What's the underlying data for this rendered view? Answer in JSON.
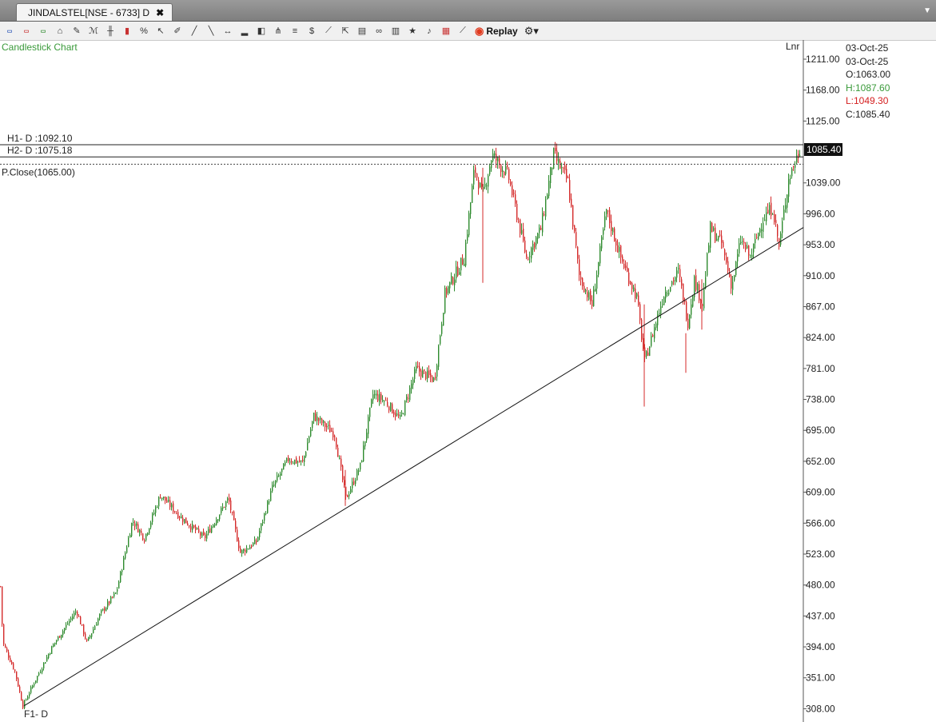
{
  "window": {
    "tab_title": "JINDALSTEL[NSE - 6733] D",
    "tab_close": "✖"
  },
  "toolbar": {
    "icons": [
      "buy-icon",
      "sell-icon",
      "trade-icon",
      "indicator-icon",
      "draw-icon",
      "studies-icon",
      "bar-style-icon",
      "candle-style-icon",
      "scale-icon",
      "cursor-icon",
      "pencil-icon",
      "line-icon",
      "diagonal-line-icon",
      "horizontal-ray-icon",
      "volume-icon",
      "cube-icon",
      "fork-icon",
      "equal-lines-icon",
      "dollar-icon",
      "ruler-icon",
      "export-icon",
      "template-icon",
      "link-icon",
      "layout-icon",
      "star-icon",
      "alert-icon",
      "hierarchy-icon",
      "trend-icon"
    ],
    "replay_label": "Replay",
    "replay_icon": "replay-icon",
    "settings_icon": "gear-icon"
  },
  "chart_label": "Candlestick Chart",
  "scale_mode": "Lnr",
  "ohlc": {
    "date1": "03-Oct-25",
    "date2": "03-Oct-25",
    "open": "O:1063.00",
    "high": "H:1087.60",
    "low": "L:1049.30",
    "close": "C:1085.40"
  },
  "colors": {
    "up": "#2e8b2e",
    "down": "#d42a2a",
    "label_green": "#3a9a3a",
    "label_red": "#d42020",
    "price_tag_bg": "#111111",
    "price_tag_text": "#ffffff"
  },
  "chart_data": {
    "type": "candlestick",
    "symbol": "JINDALSTEL",
    "interval": "D",
    "ylim": [
      300,
      1220
    ],
    "y_ticks": [
      "1211.00",
      "1168.00",
      "1125.00",
      "1085.40",
      "1039.00",
      "996.00",
      "953.00",
      "910.00",
      "867.00",
      "824.00",
      "781.00",
      "738.00",
      "695.00",
      "652.00",
      "609.00",
      "566.00",
      "523.00",
      "480.00",
      "437.00",
      "394.00",
      "351.00",
      "308.00"
    ],
    "y_tick_values": [
      1211,
      1168,
      1125,
      1085.4,
      1039,
      996,
      953,
      910,
      867,
      824,
      781,
      738,
      695,
      652,
      609,
      566,
      523,
      480,
      437,
      394,
      351,
      308
    ],
    "last_price": "1085.40",
    "last_price_value": 1085.4,
    "horizontal_levels": [
      {
        "label": "H1- D :1092.10",
        "value": 1092.1
      },
      {
        "label": "H2- D :1075.18",
        "value": 1075.18
      }
    ],
    "previous_close": {
      "label": "P.Close(1065.00)",
      "value": 1065.0
    },
    "trendline": {
      "label": "F1- D",
      "start_value": 312,
      "end_value": 977
    },
    "price_path": [
      {
        "i": 0,
        "v": 478
      },
      {
        "i": 3,
        "v": 400
      },
      {
        "i": 18,
        "v": 360
      },
      {
        "i": 28,
        "v": 312
      },
      {
        "i": 40,
        "v": 340
      },
      {
        "i": 65,
        "v": 395
      },
      {
        "i": 95,
        "v": 445
      },
      {
        "i": 108,
        "v": 400
      },
      {
        "i": 125,
        "v": 440
      },
      {
        "i": 145,
        "v": 470
      },
      {
        "i": 165,
        "v": 570
      },
      {
        "i": 180,
        "v": 545
      },
      {
        "i": 200,
        "v": 605
      },
      {
        "i": 225,
        "v": 575
      },
      {
        "i": 255,
        "v": 545
      },
      {
        "i": 285,
        "v": 600
      },
      {
        "i": 300,
        "v": 525
      },
      {
        "i": 320,
        "v": 540
      },
      {
        "i": 340,
        "v": 615
      },
      {
        "i": 360,
        "v": 655
      },
      {
        "i": 378,
        "v": 650
      },
      {
        "i": 392,
        "v": 715
      },
      {
        "i": 418,
        "v": 690
      },
      {
        "i": 432,
        "v": 600
      },
      {
        "i": 450,
        "v": 645
      },
      {
        "i": 466,
        "v": 745
      },
      {
        "i": 482,
        "v": 735
      },
      {
        "i": 500,
        "v": 710
      },
      {
        "i": 520,
        "v": 780
      },
      {
        "i": 543,
        "v": 765
      },
      {
        "i": 556,
        "v": 885
      },
      {
        "i": 580,
        "v": 935
      },
      {
        "i": 593,
        "v": 1060
      },
      {
        "i": 603,
        "v": 1020
      },
      {
        "i": 615,
        "v": 1078
      },
      {
        "i": 635,
        "v": 1050
      },
      {
        "i": 658,
        "v": 935
      },
      {
        "i": 676,
        "v": 975
      },
      {
        "i": 692,
        "v": 1078
      },
      {
        "i": 710,
        "v": 1040
      },
      {
        "i": 724,
        "v": 910
      },
      {
        "i": 740,
        "v": 870
      },
      {
        "i": 758,
        "v": 1000
      },
      {
        "i": 776,
        "v": 935
      },
      {
        "i": 796,
        "v": 880
      },
      {
        "i": 806,
        "v": 790
      },
      {
        "i": 830,
        "v": 885
      },
      {
        "i": 848,
        "v": 915
      },
      {
        "i": 860,
        "v": 845
      },
      {
        "i": 868,
        "v": 905
      },
      {
        "i": 878,
        "v": 870
      },
      {
        "i": 888,
        "v": 975
      },
      {
        "i": 902,
        "v": 955
      },
      {
        "i": 915,
        "v": 895
      },
      {
        "i": 926,
        "v": 960
      },
      {
        "i": 938,
        "v": 935
      },
      {
        "i": 954,
        "v": 990
      },
      {
        "i": 966,
        "v": 1005
      },
      {
        "i": 974,
        "v": 950
      },
      {
        "i": 986,
        "v": 1045
      },
      {
        "i": 1000,
        "v": 1085.4
      }
    ]
  }
}
